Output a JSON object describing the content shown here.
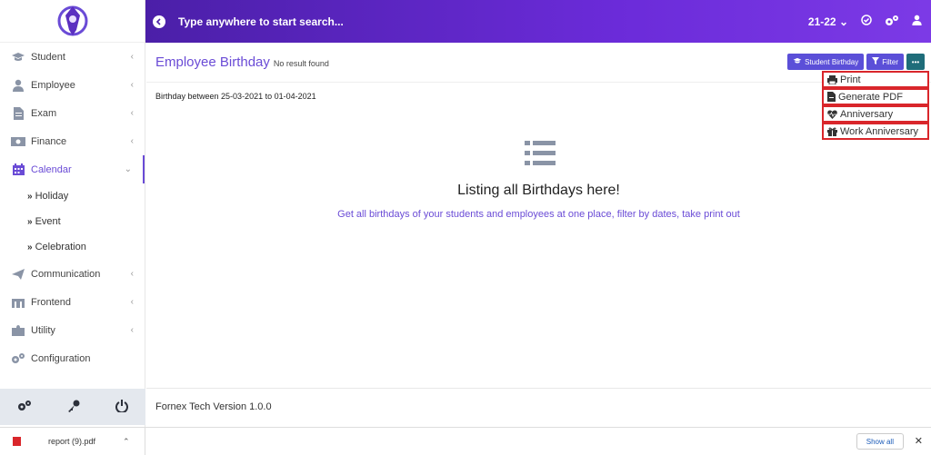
{
  "sidebar": {
    "items": [
      {
        "label": "Student",
        "icon": "graduation-cap-icon"
      },
      {
        "label": "Employee",
        "icon": "user-icon"
      },
      {
        "label": "Exam",
        "icon": "document-icon"
      },
      {
        "label": "Finance",
        "icon": "money-icon"
      },
      {
        "label": "Calendar",
        "icon": "calendar-icon",
        "active": true
      },
      {
        "label": "Communication",
        "icon": "paper-plane-icon"
      },
      {
        "label": "Frontend",
        "icon": "building-icon"
      },
      {
        "label": "Utility",
        "icon": "puzzle-icon"
      },
      {
        "label": "Configuration",
        "icon": "gears-icon"
      }
    ],
    "calendar_sub": [
      {
        "label": "Holiday"
      },
      {
        "label": "Event"
      },
      {
        "label": "Celebration"
      }
    ]
  },
  "topbar": {
    "search_placeholder": "Type anywhere to start search...",
    "session": "21-22"
  },
  "page": {
    "title": "Employee Birthday",
    "status": "No result found",
    "student_birthday_btn": "Student Birthday",
    "filter_btn": "Filter",
    "range": "Birthday between 25-03-2021 to 01-04-2021",
    "empty_title": "Listing all Birthdays here!",
    "empty_sub": "Get all birthdays of your students and employees at one place, filter by dates, take print out"
  },
  "dropdown": [
    {
      "label": "Print",
      "icon": "print-icon"
    },
    {
      "label": "Generate PDF",
      "icon": "pdf-icon"
    },
    {
      "label": "Anniversary",
      "icon": "heartbeat-icon"
    },
    {
      "label": "Work Anniversary",
      "icon": "gift-icon"
    }
  ],
  "footer": {
    "version": "Fornex Tech Version 1.0.0"
  },
  "downloads": {
    "file": "report (9).pdf",
    "show_all": "Show all"
  },
  "colors": {
    "accent": "#6a4bd6",
    "topbar": "#6b2bd9",
    "highlight": "#d9262b"
  }
}
